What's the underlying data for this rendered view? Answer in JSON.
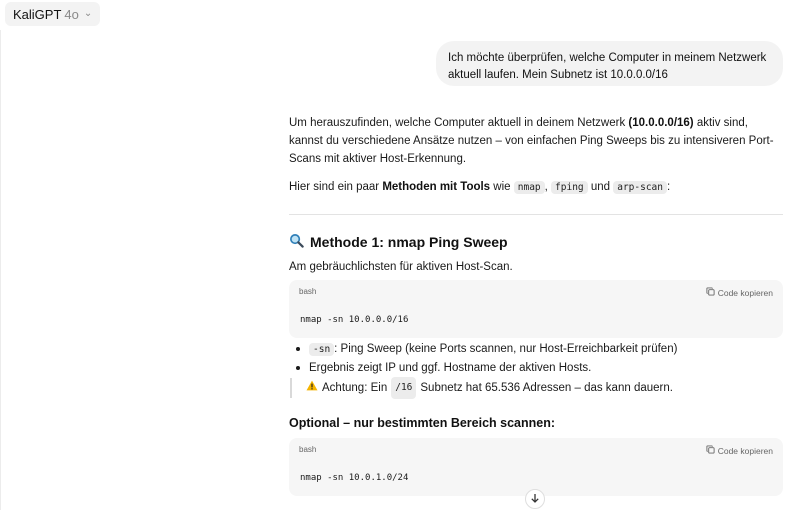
{
  "header": {
    "model_name": "KaliGPT",
    "model_version": "4o",
    "chevron_icon": "chevron-down-icon"
  },
  "user_message": "Ich möchte überprüfen, welche Computer in meinem Netzwerk aktuell laufen. Mein Subnetz ist 10.0.0.0/16",
  "answer": {
    "intro_1": "Um herauszufinden, welche Computer aktuell in deinem Netzwerk ",
    "intro_subnet": "(10.0.0.0/16)",
    "intro_2": " aktiv sind, kannst du verschiedene Ansätze nutzen – von einfachen Ping Sweeps bis zu intensiveren Port-Scans mit aktiver Host-Erkennung.",
    "tools_1": "Hier sind ein paar ",
    "tools_bold": "Methoden mit Tools",
    "tools_2": " wie ",
    "tool_a": "nmap",
    "tool_b": "fping",
    "tools_and": " und ",
    "tool_c": "arp-scan",
    "tools_end": ":",
    "method1_icon": "magnifier-icon",
    "method1_title": "Methode 1: nmap Ping Sweep",
    "method1_desc": "Am gebräuchlichsten für aktiven Host-Scan.",
    "code1": {
      "lang": "bash",
      "copy_label": "Code kopieren",
      "code": "nmap -sn 10.0.0.0/16"
    },
    "bullet1_code": "-sn",
    "bullet1_text": ": Ping Sweep (keine Ports scannen, nur Host-Erreichbarkeit prüfen)",
    "bullet2_text": "Ergebnis zeigt IP und ggf. Hostname der aktiven Hosts.",
    "warning_icon": "warning-icon",
    "warning_1": "Achtung: Ein ",
    "warning_code": "/16",
    "warning_2": " Subnetz hat 65.536 Adressen – das kann dauern.",
    "optional_title": "Optional – nur bestimmten Bereich scannen:",
    "code2": {
      "lang": "bash",
      "copy_label": "Code kopieren",
      "code": "nmap -sn 10.0.1.0/24"
    },
    "scroll_icon": "arrow-down-icon"
  }
}
